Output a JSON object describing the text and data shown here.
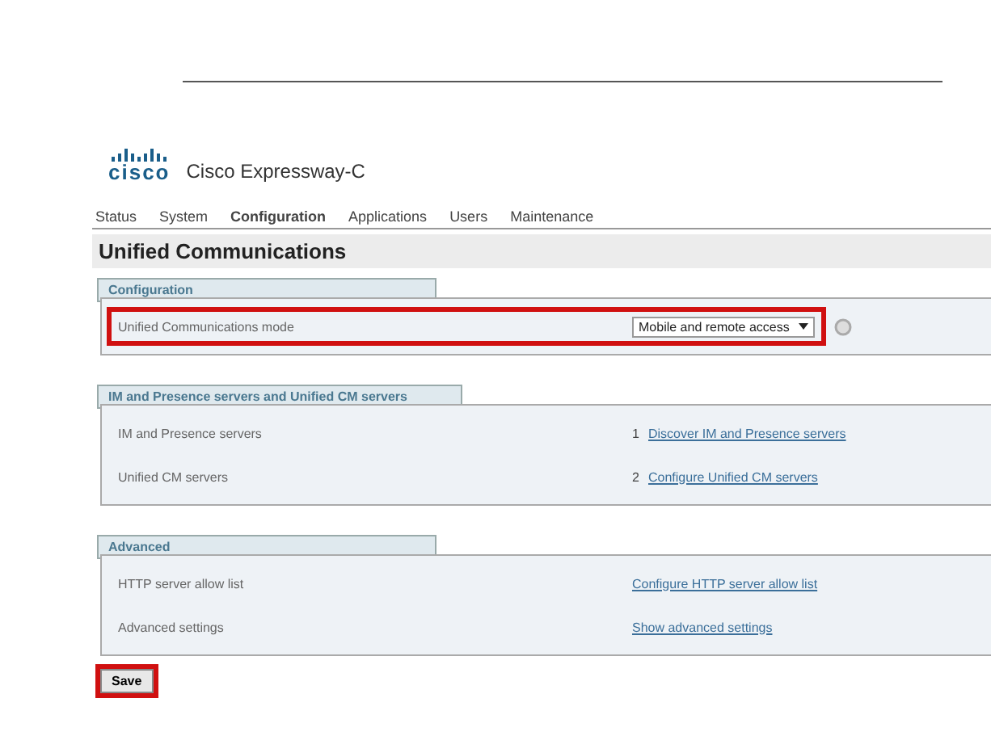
{
  "brand": {
    "logo": "cisco",
    "product": "Cisco Expressway-C"
  },
  "nav": [
    {
      "label": "Status",
      "selected": false
    },
    {
      "label": "System",
      "selected": false
    },
    {
      "label": "Configuration",
      "selected": true
    },
    {
      "label": "Applications",
      "selected": false
    },
    {
      "label": "Users",
      "selected": false
    },
    {
      "label": "Maintenance",
      "selected": false
    }
  ],
  "page_title": "Unified Communications",
  "sections": [
    {
      "title": "Configuration",
      "rows": [
        {
          "kind": "select",
          "label": "Unified Communications mode",
          "value": "Mobile and remote access",
          "highlighted": true
        }
      ]
    },
    {
      "title": "IM and Presence servers and Unified CM servers",
      "rows": [
        {
          "kind": "link",
          "label": "IM and Presence servers",
          "step": "1",
          "link": "Discover IM and Presence servers"
        },
        {
          "kind": "link",
          "label": "Unified CM servers",
          "step": "2",
          "link": "Configure Unified CM servers"
        }
      ]
    },
    {
      "title": "Advanced",
      "rows": [
        {
          "kind": "link",
          "label": "HTTP server allow list",
          "link": "Configure HTTP server allow list"
        },
        {
          "kind": "link",
          "label": "Advanced settings",
          "link": "Show advanced settings"
        }
      ]
    }
  ],
  "save": {
    "label": "Save",
    "highlighted": true
  }
}
